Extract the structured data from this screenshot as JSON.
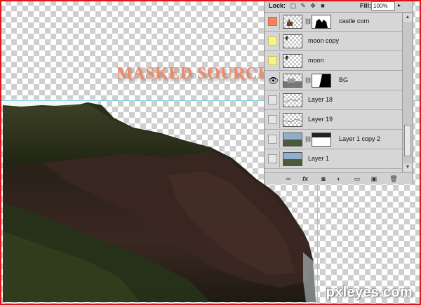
{
  "overlay_label": "MASKED SOURCE",
  "watermark": "pxleyes.com",
  "layers_panel": {
    "lock_label": "Lock:",
    "fill_label": "Fill:",
    "fill_value": "100%",
    "layers": [
      {
        "name": "castle corn",
        "visibility": "orange",
        "mask": true
      },
      {
        "name": "moon copy",
        "visibility": "yellow",
        "mask": false
      },
      {
        "name": "moon",
        "visibility": "yellow",
        "mask": false
      },
      {
        "name": "BG",
        "visibility": "eye",
        "mask": true
      },
      {
        "name": "Layer 18",
        "visibility": "none",
        "mask": false
      },
      {
        "name": "Layer 19",
        "visibility": "none",
        "mask": false
      },
      {
        "name": "Layer 1 copy 2",
        "visibility": "none",
        "mask": true
      },
      {
        "name": "Layer 1",
        "visibility": "none",
        "mask": false
      }
    ]
  },
  "colors": {
    "orange_tag": "#f0875a",
    "yellow_tag": "#f7f28c",
    "guide": "#5fd2d8",
    "border": "#e0141b",
    "label": "#ef8a68"
  },
  "icons": [
    "eye-icon",
    "chain-icon",
    "link-icon",
    "fx-icon",
    "mask-icon",
    "adjustment-icon",
    "folder-icon",
    "new-layer-icon",
    "trash-icon",
    "lock-transparent-icon",
    "lock-paint-icon",
    "lock-move-icon",
    "lock-all-icon"
  ]
}
